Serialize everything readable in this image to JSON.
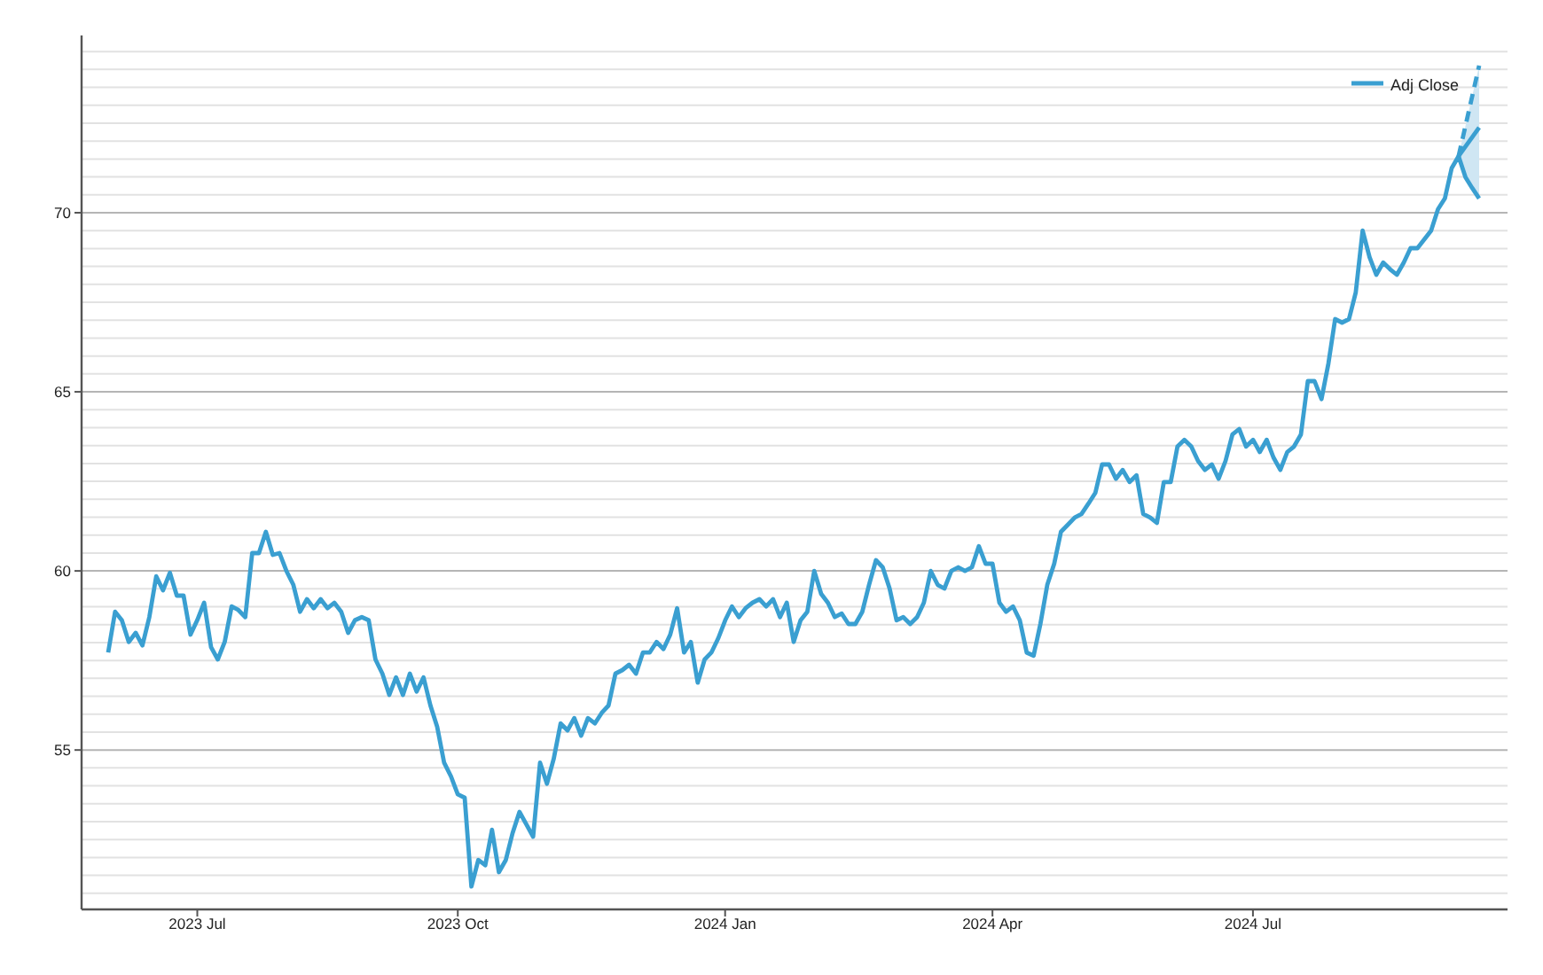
{
  "chart_data": {
    "type": "line",
    "grid": true,
    "ylim": [
      50.55,
      74.85
    ],
    "categories": [
      null,
      null,
      null,
      null,
      null,
      null,
      null,
      null,
      null,
      null,
      null,
      null,
      null,
      "2023 Jul",
      null,
      null,
      null,
      null,
      null,
      null,
      null,
      null,
      null,
      null,
      null,
      null,
      null,
      null,
      null,
      null,
      null,
      null,
      null,
      null,
      null,
      null,
      null,
      null,
      null,
      null,
      null,
      null,
      null,
      null,
      null,
      null,
      null,
      null,
      null,
      null,
      null,
      "2023 Oct",
      null,
      null,
      null,
      null,
      null,
      null,
      null,
      null,
      null,
      null,
      null,
      null,
      null,
      null,
      null,
      null,
      null,
      null,
      null,
      null,
      null,
      null,
      null,
      null,
      null,
      null,
      null,
      null,
      null,
      null,
      null,
      null,
      null,
      null,
      null,
      null,
      null,
      null,
      "2024 Jan",
      null,
      null,
      null,
      null,
      null,
      null,
      null,
      null,
      null,
      null,
      null,
      null,
      null,
      null,
      null,
      null,
      null,
      null,
      null,
      null,
      null,
      null,
      null,
      null,
      null,
      null,
      null,
      null,
      null,
      null,
      null,
      null,
      null,
      null,
      null,
      null,
      null,
      null,
      "2024 Apr",
      null,
      null,
      null,
      null,
      null,
      null,
      null,
      null,
      null,
      null,
      null,
      null,
      null,
      null,
      null,
      null,
      null,
      null,
      null,
      null,
      null,
      null,
      null,
      null,
      null,
      null,
      null,
      null,
      null,
      null,
      null,
      null,
      null,
      null,
      null,
      null,
      null,
      "2024 Jul",
      null,
      null,
      null,
      null,
      null,
      null,
      null,
      null,
      null,
      null,
      null,
      null,
      null,
      null,
      null,
      null,
      null,
      null,
      null,
      null,
      null,
      null,
      null,
      null,
      null,
      null,
      null,
      null,
      null,
      null,
      null,
      null,
      null
    ],
    "yticks": [
      55,
      60,
      65,
      70
    ],
    "series": [
      {
        "name": "Adj Close",
        "color": "#3a9fd1",
        "values": [
          57.72,
          58.86,
          58.62,
          58.02,
          58.27,
          57.92,
          58.71,
          59.85,
          59.46,
          59.95,
          59.31,
          59.31,
          58.22,
          58.62,
          59.11,
          57.87,
          57.53,
          58.02,
          59.01,
          58.91,
          58.71,
          60.5,
          60.5,
          61.09,
          60.45,
          60.5,
          60.0,
          59.61,
          58.86,
          59.21,
          58.96,
          59.21,
          58.96,
          59.11,
          58.86,
          58.27,
          58.62,
          58.71,
          58.62,
          57.53,
          57.13,
          56.54,
          57.03,
          56.54,
          57.13,
          56.63,
          57.03,
          56.24,
          55.65,
          54.65,
          54.26,
          53.76,
          53.67,
          51.19,
          51.93,
          51.78,
          52.77,
          51.59,
          51.93,
          52.68,
          53.27,
          52.92,
          52.58,
          54.65,
          54.06,
          54.75,
          55.74,
          55.55,
          55.89,
          55.4,
          55.89,
          55.74,
          56.04,
          56.24,
          57.13,
          57.23,
          57.38,
          57.13,
          57.72,
          57.72,
          58.02,
          57.82,
          58.22,
          58.96,
          57.72,
          58.02,
          56.88,
          57.53,
          57.72,
          58.12,
          58.62,
          59.01,
          58.71,
          58.96,
          59.11,
          59.21,
          59.01,
          59.21,
          58.71,
          59.11,
          58.02,
          58.62,
          58.86,
          60.0,
          59.36,
          59.11,
          58.71,
          58.81,
          58.52,
          58.52,
          58.86,
          59.61,
          60.3,
          60.1,
          59.51,
          58.62,
          58.71,
          58.52,
          58.71,
          59.11,
          60.0,
          59.61,
          59.51,
          60.0,
          60.1,
          60.0,
          60.1,
          60.69,
          60.2,
          60.2,
          59.11,
          58.86,
          59.01,
          58.62,
          57.72,
          57.63,
          58.52,
          59.61,
          60.2,
          61.09,
          61.29,
          61.49,
          61.59,
          61.88,
          62.18,
          62.97,
          62.97,
          62.57,
          62.82,
          62.48,
          62.67,
          61.59,
          61.49,
          61.34,
          62.48,
          62.48,
          63.47,
          63.66,
          63.47,
          63.07,
          62.82,
          62.97,
          62.57,
          63.07,
          63.81,
          63.96,
          63.47,
          63.66,
          63.32,
          63.66,
          63.17,
          62.82,
          63.32,
          63.47,
          63.81,
          65.3,
          65.3,
          64.8,
          65.79,
          67.03,
          66.93,
          67.03,
          67.77,
          69.5,
          68.76,
          68.27,
          68.61,
          68.42,
          68.27,
          68.61,
          69.01,
          69.01,
          69.26,
          69.5,
          70.1,
          70.4,
          71.24,
          71.58,
          70.99,
          70.69,
          70.4
        ]
      },
      {
        "color": "#3a9fd1",
        "line_style": "dashed",
        "values": [
          null,
          null,
          null,
          null,
          null,
          null,
          null,
          null,
          null,
          null,
          null,
          null,
          null,
          null,
          null,
          null,
          null,
          null,
          null,
          null,
          null,
          null,
          null,
          null,
          null,
          null,
          null,
          null,
          null,
          null,
          null,
          null,
          null,
          null,
          null,
          null,
          null,
          null,
          null,
          null,
          null,
          null,
          null,
          null,
          null,
          null,
          null,
          null,
          null,
          null,
          null,
          null,
          null,
          null,
          null,
          null,
          null,
          null,
          null,
          null,
          null,
          null,
          null,
          null,
          null,
          null,
          null,
          null,
          null,
          null,
          null,
          null,
          null,
          null,
          null,
          null,
          null,
          null,
          null,
          null,
          null,
          null,
          null,
          null,
          null,
          null,
          null,
          null,
          null,
          null,
          null,
          null,
          null,
          null,
          null,
          null,
          null,
          null,
          null,
          null,
          null,
          null,
          null,
          null,
          null,
          null,
          null,
          null,
          null,
          null,
          null,
          null,
          null,
          null,
          null,
          null,
          null,
          null,
          null,
          null,
          null,
          null,
          null,
          null,
          null,
          null,
          null,
          null,
          null,
          null,
          null,
          null,
          null,
          null,
          null,
          null,
          null,
          null,
          null,
          null,
          null,
          null,
          null,
          null,
          null,
          null,
          null,
          null,
          null,
          null,
          null,
          null,
          null,
          null,
          null,
          null,
          null,
          null,
          null,
          null,
          null,
          null,
          null,
          null,
          null,
          null,
          null,
          null,
          null,
          null,
          null,
          null,
          null,
          null,
          null,
          null,
          null,
          null,
          null,
          null,
          null,
          null,
          null,
          null,
          null,
          null,
          null,
          null,
          null,
          null,
          null,
          null,
          null,
          null,
          null,
          null,
          null,
          71.58,
          null,
          null,
          74.11
        ]
      },
      {
        "color": "#3a9fd1",
        "values": [
          null,
          null,
          null,
          null,
          null,
          null,
          null,
          null,
          null,
          null,
          null,
          null,
          null,
          null,
          null,
          null,
          null,
          null,
          null,
          null,
          null,
          null,
          null,
          null,
          null,
          null,
          null,
          null,
          null,
          null,
          null,
          null,
          null,
          null,
          null,
          null,
          null,
          null,
          null,
          null,
          null,
          null,
          null,
          null,
          null,
          null,
          null,
          null,
          null,
          null,
          null,
          null,
          null,
          null,
          null,
          null,
          null,
          null,
          null,
          null,
          null,
          null,
          null,
          null,
          null,
          null,
          null,
          null,
          null,
          null,
          null,
          null,
          null,
          null,
          null,
          null,
          null,
          null,
          null,
          null,
          null,
          null,
          null,
          null,
          null,
          null,
          null,
          null,
          null,
          null,
          null,
          null,
          null,
          null,
          null,
          null,
          null,
          null,
          null,
          null,
          null,
          null,
          null,
          null,
          null,
          null,
          null,
          null,
          null,
          null,
          null,
          null,
          null,
          null,
          null,
          null,
          null,
          null,
          null,
          null,
          null,
          null,
          null,
          null,
          null,
          null,
          null,
          null,
          null,
          null,
          null,
          null,
          null,
          null,
          null,
          null,
          null,
          null,
          null,
          null,
          null,
          null,
          null,
          null,
          null,
          null,
          null,
          null,
          null,
          null,
          null,
          null,
          null,
          null,
          null,
          null,
          null,
          null,
          null,
          null,
          null,
          null,
          null,
          null,
          null,
          null,
          null,
          null,
          null,
          null,
          null,
          null,
          null,
          null,
          null,
          null,
          null,
          null,
          null,
          null,
          null,
          null,
          null,
          null,
          null,
          null,
          null,
          null,
          null,
          null,
          null,
          null,
          null,
          null,
          null,
          null,
          null,
          71.58,
          null,
          null,
          72.38
        ]
      }
    ]
  }
}
